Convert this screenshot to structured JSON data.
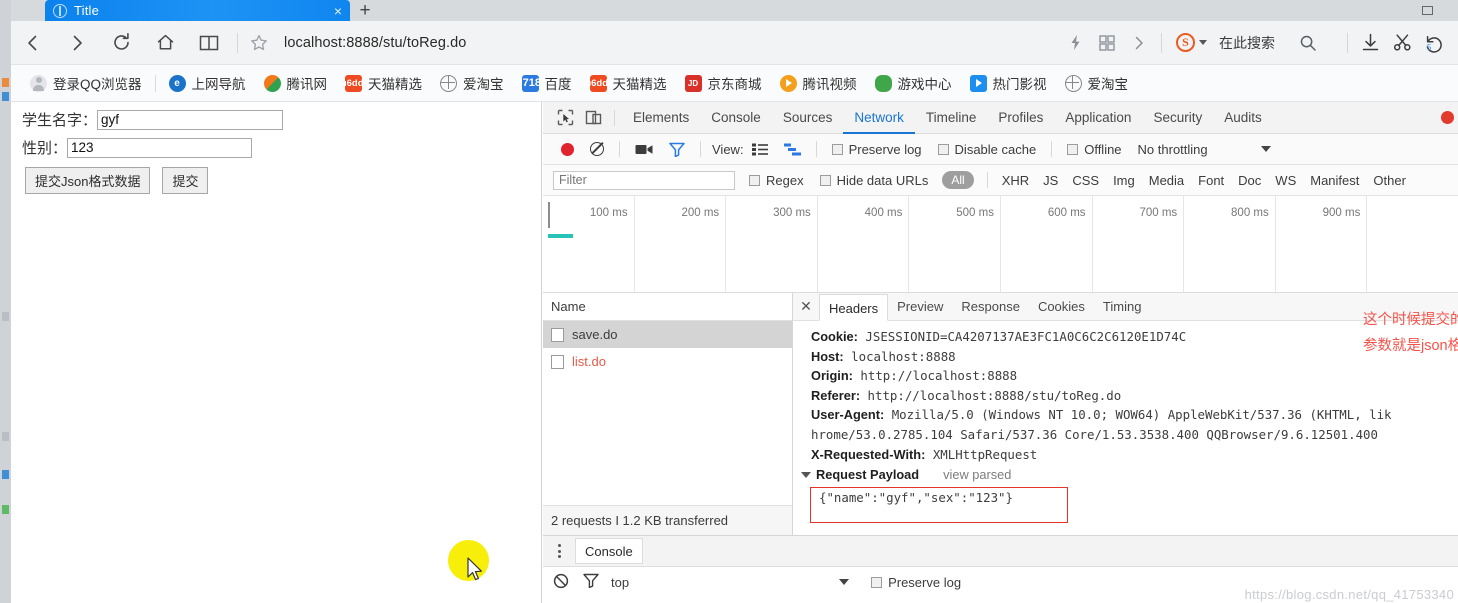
{
  "browser": {
    "tab": {
      "title": "Title",
      "close": "×"
    },
    "new_tab": "+",
    "address": "localhost:8888/stu/toReg.do",
    "search_placeholder": "在此搜索",
    "bookmarks": [
      {
        "label": "登录QQ浏览器",
        "icon": "avatar-icon",
        "color": "#e3e5e8"
      },
      {
        "label": "上网导航",
        "icon": "e-circle-icon",
        "color": "#1a73c8"
      },
      {
        "label": "腾讯网",
        "icon": "tencent-icon",
        "color": "#f07a1a"
      },
      {
        "label": "天猫精选",
        "icon": "taobao-icon",
        "color": "#ef4b22"
      },
      {
        "label": "爱淘宝",
        "icon": "globe-icon",
        "color": "#888888"
      },
      {
        "label": "百度",
        "icon": "baidu-icon",
        "color": "#2a7ae2"
      },
      {
        "label": "天猫精选",
        "icon": "taobao-icon",
        "color": "#ef4b22"
      },
      {
        "label": "京东商城",
        "icon": "jd-icon",
        "color": "#d9302a"
      },
      {
        "label": "腾讯视频",
        "icon": "tencent-video-icon",
        "color": "#f4a01c"
      },
      {
        "label": "游戏中心",
        "icon": "gamepad-icon",
        "color": "#3fa64a"
      },
      {
        "label": "热门影视",
        "icon": "video-play-icon",
        "color": "#1b8ef0"
      },
      {
        "label": "爱淘宝",
        "icon": "globe-icon",
        "color": "#888888"
      }
    ]
  },
  "page": {
    "name_label": "学生名字：",
    "name_value": "gyf",
    "sex_label": "性别：",
    "sex_value": "123",
    "json_submit_label": "提交Json格式数据",
    "submit_label": "提交"
  },
  "devtools": {
    "panels": [
      "Elements",
      "Console",
      "Sources",
      "Network",
      "Timeline",
      "Profiles",
      "Application",
      "Security",
      "Audits"
    ],
    "active_panel": "Network",
    "toolbar": {
      "view_label": "View:",
      "preserve_log": "Preserve log",
      "disable_cache": "Disable cache",
      "offline": "Offline",
      "throttling": "No throttling"
    },
    "filter": {
      "placeholder": "Filter",
      "regex": "Regex",
      "hide_data_urls": "Hide data URLs",
      "all": "All",
      "types": [
        "XHR",
        "JS",
        "CSS",
        "Img",
        "Media",
        "Font",
        "Doc",
        "WS",
        "Manifest",
        "Other"
      ]
    },
    "overview_ticks": [
      "100 ms",
      "200 ms",
      "300 ms",
      "400 ms",
      "500 ms",
      "600 ms",
      "700 ms",
      "800 ms",
      "900 ms"
    ],
    "requests": {
      "column": "Name",
      "rows": [
        {
          "name": "save.do",
          "selected": true,
          "error": false
        },
        {
          "name": "list.do",
          "selected": false,
          "error": true
        }
      ],
      "summary": "2 requests  I  1.2 KB transferred"
    },
    "detail": {
      "tabs": [
        "Headers",
        "Preview",
        "Response",
        "Cookies",
        "Timing"
      ],
      "active_tab": "Headers",
      "headers": [
        {
          "key": "Cookie:",
          "value": "JSESSIONID=CA4207137AE3FC1A0C6C2C6120E1D74C"
        },
        {
          "key": "Host:",
          "value": "localhost:8888"
        },
        {
          "key": "Origin:",
          "value": "http://localhost:8888"
        },
        {
          "key": "Referer:",
          "value": "http://localhost:8888/stu/toReg.do"
        },
        {
          "key": "User-Agent:",
          "value": "Mozilla/5.0 (Windows NT 10.0; WOW64) AppleWebKit/537.36 (KHTML, lik"
        },
        {
          "key": "",
          "value": "hrome/53.0.2785.104 Safari/537.36 Core/1.53.3538.400 QQBrowser/9.6.12501.400"
        },
        {
          "key": "X-Requested-With:",
          "value": "XMLHttpRequest"
        }
      ],
      "payload_title": "Request Payload",
      "payload_view_parsed": "view parsed",
      "payload_body": "{\"name\":\"gyf\",\"sex\":\"123\"}"
    },
    "drawer": {
      "tab": "Console",
      "context": "top",
      "preserve_log": "Preserve log"
    }
  },
  "annotation": {
    "line1": "这个时候提交的请求，",
    "line2": "参数就是json格式的了",
    "color": "#f5534a"
  },
  "watermark": "https://blog.csdn.net/qq_41753340"
}
